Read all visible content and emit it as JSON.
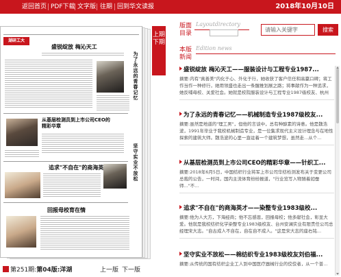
{
  "topnav": {
    "home": "返回首页",
    "pdf": "PDF下载",
    "text": "文字版",
    "past": "往期",
    "back_old": "回到华文读报",
    "date": "2018年10月10日"
  },
  "paper_preview": {
    "section_badge": "湖研工大",
    "headlines": [
      "盛锐绽放 梅沁天工",
      "从基层检测员到上市公司CEO的精彩华章",
      "追求\"不自在\"的商海英才",
      "回报母校育在情"
    ],
    "vertical_titles": [
      "为了永远的青春记忆",
      "坚守实业不放松"
    ]
  },
  "ribbon": {
    "text": "上期 下期"
  },
  "bottom": {
    "issue_label": "第251期:",
    "page_label": "第04版:洋湖",
    "prev_page": "上一版",
    "next_page": "下一版"
  },
  "right": {
    "layout_title": "版面目录",
    "layout_en": "Layoutdirectory",
    "search_placeholder": "请输入关键字",
    "search_button": "搜索",
    "news_title": "本版新闻",
    "news_en": "Edition news"
  },
  "news_items": [
    {
      "title": "盛锐绽放 梅沁天工——服装设计与工程专业1987...",
      "summary": "摘要:内有\"真善美\"内化于心、外化于行，她收获了客户信任和高赢口碑；将工作当作一种修行，她用领盛也走出一条醒推划展之路；将事献作为一种追求，她反哺母校、关爱社会。她就是校院服装设计与工程专业1987级校友、杭州最..."
    },
    {
      "title": "为了永远的青春记忆——机械制造专业1987级校友...",
      "summary": "摘要:虽然是地道的\"理工男\"，但他的言谈中，总有种醇素的诗意。他是魏浩波，1991年毕业于我校机械制造专业，是一位集求现代主义设计理念与在地性探索的建筑大师。魏浩波的心里一直驻着一个建筑梦想，虽然走...从个..."
    },
    {
      "title": "从基层检测员到上市公司CEO的精彩华章——针织工...",
      "summary": "摘要:2018年6月5日，中国纺织行业将军上市公司华纺检测发布关于变更公司总裁的公告，一时间，国内主流体育纷纷报道，\"行业览写入物随着如蚕师...\"不..."
    },
    {
      "title": "追求\"不自在\"的商海英才——染整专业1983级校...",
      "summary": "摘要:他为人大方，下海经商；他不忘感恩，回报母校；他多献社会，彰显大爱。他就是我校纺织化学染整专业1983级校友、台州安澜实业有限责任公司总经理宋大志。\"自古成人不自在，自在自不成人。\"这是宋大志的座右铭..."
    },
    {
      "title": "坚守实业不放松——棉纺织专业1983级校友刘伯福...",
      "summary": "摘要:从传统的国有纺织企业工人到中国医疗器械行业的佼佼者，从一个普..."
    }
  ]
}
